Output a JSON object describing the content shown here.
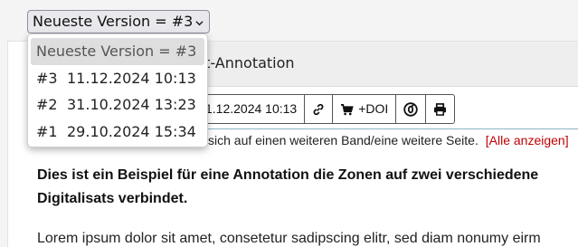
{
  "version_select": {
    "selected": "Neueste Version = #3"
  },
  "dropdown": {
    "options": [
      {
        "label": "Neueste Version = #3",
        "num": "",
        "date": "",
        "selected": true
      },
      {
        "label": "",
        "num": "#3",
        "date": "11.12.2024 10:13",
        "selected": false
      },
      {
        "label": "",
        "num": "#2",
        "date": "31.10.2024 13:23",
        "selected": false
      },
      {
        "label": "",
        "num": "#1",
        "date": "29.10.2024 15:34",
        "selected": false
      }
    ]
  },
  "panel": {
    "title_visible": "arget-Annotation"
  },
  "toolbar": {
    "date_visible": "1.12.2024 10:13",
    "link_icon": "link-icon",
    "cart_icon": "cart-icon",
    "doi_label": "+DOI",
    "oa_icon": "open-access-icon",
    "print_icon": "print-icon"
  },
  "info": {
    "text_visible": "sich auf einen weiteren Band/eine weitere Seite.",
    "link": "[Alle anzeigen]",
    "link_color": "#c00000"
  },
  "content": {
    "bold_line1": "Dies ist ein Beispiel für eine Annotation die Zonen auf zwei verschiedene",
    "bold_line2": "Digitalisats verbindet.",
    "lorem": "Lorem ipsum dolor sit amet, consetetur sadipscing elitr, sed diam nonumy eirm"
  }
}
